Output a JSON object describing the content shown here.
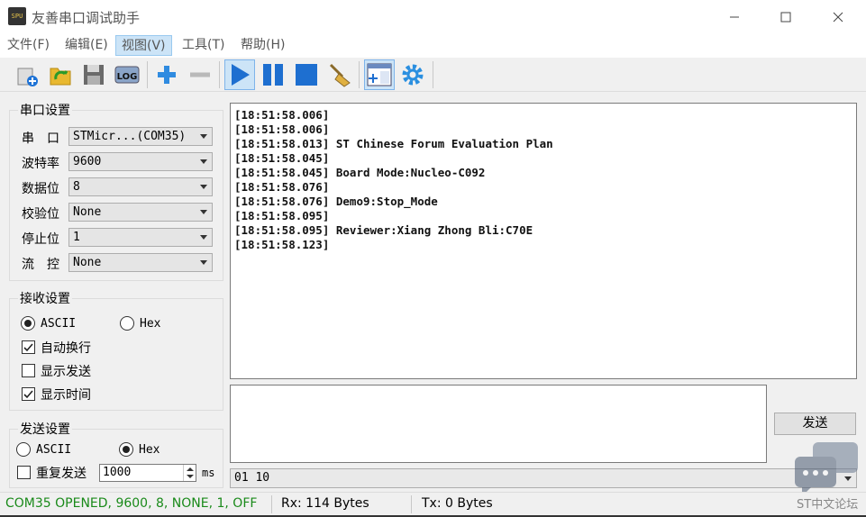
{
  "window": {
    "title": "友善串口调试助手",
    "app_icon_text": "SPU",
    "minimize": "—",
    "maximize": "☐",
    "close": "✕"
  },
  "menu": {
    "items": [
      {
        "label": "文件(F)"
      },
      {
        "label": "编辑(E)"
      },
      {
        "label": "视图(V)"
      },
      {
        "label": "工具(T)"
      },
      {
        "label": "帮助(H)"
      }
    ],
    "active_index": 2
  },
  "toolbar": {
    "buttons": [
      "new-icon",
      "open-icon",
      "save-icon",
      "log-icon",
      "add-icon",
      "remove-icon",
      "play-icon",
      "pause-icon",
      "stop-icon",
      "clear-icon",
      "layout-icon",
      "settings-icon"
    ],
    "log_label": "LOG"
  },
  "serial": {
    "group_title": "串口设置",
    "port_label": "串　口",
    "port_value": "STMicr...(COM35)",
    "baud_label": "波特率",
    "baud_value": "9600",
    "databits_label": "数据位",
    "databits_value": "8",
    "parity_label": "校验位",
    "parity_value": "None",
    "stopbits_label": "停止位",
    "stopbits_value": "1",
    "flow_label": "流　控",
    "flow_value": "None"
  },
  "receive": {
    "group_title": "接收设置",
    "ascii_label": "ASCII",
    "hex_label": "Hex",
    "mode": "ASCII",
    "auto_wrap_label": "自动换行",
    "auto_wrap": true,
    "show_send_label": "显示发送",
    "show_send": false,
    "show_time_label": "显示时间",
    "show_time": true
  },
  "send": {
    "group_title": "发送设置",
    "ascii_label": "ASCII",
    "hex_label": "Hex",
    "mode": "Hex",
    "repeat_label": "重复发送",
    "repeat": false,
    "interval_value": "1000",
    "interval_unit": "ms",
    "send_button": "发送",
    "history_value": "01 10"
  },
  "rx_log": [
    "[18:51:58.006]",
    "[18:51:58.006]",
    "[18:51:58.013] ST Chinese Forum Evaluation Plan",
    "[18:51:58.045]",
    "[18:51:58.045] Board Mode:Nucleo-C092",
    "[18:51:58.076]",
    "[18:51:58.076] Demo9:Stop_Mode",
    "[18:51:58.095]",
    "[18:51:58.095] Reviewer:Xiang Zhong Bli:C70E",
    "[18:51:58.123]"
  ],
  "status": {
    "connection": "COM35 OPENED, 9600, 8, NONE, 1, OFF",
    "connection_color": "#1a8a1a",
    "rx": "Rx: 114 Bytes",
    "tx": "Tx: 0 Bytes"
  },
  "watermark": {
    "text": "ST中文论坛"
  }
}
